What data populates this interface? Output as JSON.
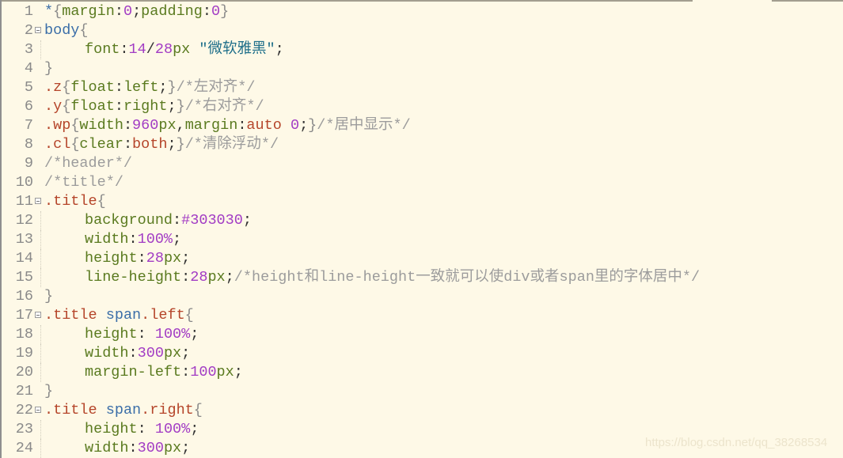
{
  "editor": {
    "background": "#fef9e7",
    "lines": [
      {
        "n": "1",
        "fold": false,
        "indent": false,
        "tokens": [
          {
            "t": "*",
            "c": "tag"
          },
          {
            "t": "{",
            "c": "brace"
          },
          {
            "t": "margin",
            "c": "prop"
          },
          {
            "t": ":",
            "c": "pun"
          },
          {
            "t": "0",
            "c": "num"
          },
          {
            "t": ";",
            "c": "pun"
          },
          {
            "t": "padding",
            "c": "prop"
          },
          {
            "t": ":",
            "c": "pun"
          },
          {
            "t": "0",
            "c": "num"
          },
          {
            "t": "}",
            "c": "brace"
          }
        ]
      },
      {
        "n": "2",
        "fold": true,
        "indent": false,
        "tokens": [
          {
            "t": "body",
            "c": "tag"
          },
          {
            "t": "{",
            "c": "brace"
          }
        ]
      },
      {
        "n": "3",
        "fold": false,
        "indent": true,
        "tokens": [
          {
            "t": "font",
            "c": "prop"
          },
          {
            "t": ":",
            "c": "pun"
          },
          {
            "t": "14",
            "c": "num"
          },
          {
            "t": "/",
            "c": "pun"
          },
          {
            "t": "28",
            "c": "num"
          },
          {
            "t": "px",
            "c": "prop"
          },
          {
            "t": " ",
            "c": "pun"
          },
          {
            "t": "\"微软雅黑\"",
            "c": "str"
          },
          {
            "t": ";",
            "c": "pun"
          }
        ]
      },
      {
        "n": "4",
        "fold": false,
        "indent": false,
        "tokens": [
          {
            "t": "}",
            "c": "brace"
          }
        ]
      },
      {
        "n": "5",
        "fold": false,
        "indent": false,
        "tokens": [
          {
            "t": ".z",
            "c": "sel"
          },
          {
            "t": "{",
            "c": "brace"
          },
          {
            "t": "float",
            "c": "prop"
          },
          {
            "t": ":",
            "c": "pun"
          },
          {
            "t": "left",
            "c": "prop"
          },
          {
            "t": ";",
            "c": "pun"
          },
          {
            "t": "}",
            "c": "brace"
          },
          {
            "t": "/*左对齐*/",
            "c": "cmt"
          }
        ]
      },
      {
        "n": "6",
        "fold": false,
        "indent": false,
        "tokens": [
          {
            "t": ".y",
            "c": "sel"
          },
          {
            "t": "{",
            "c": "brace"
          },
          {
            "t": "float",
            "c": "prop"
          },
          {
            "t": ":",
            "c": "pun"
          },
          {
            "t": "right",
            "c": "prop"
          },
          {
            "t": ";",
            "c": "pun"
          },
          {
            "t": "}",
            "c": "brace"
          },
          {
            "t": "/*右对齐*/",
            "c": "cmt"
          }
        ]
      },
      {
        "n": "7",
        "fold": false,
        "indent": false,
        "tokens": [
          {
            "t": ".wp",
            "c": "sel"
          },
          {
            "t": "{",
            "c": "brace"
          },
          {
            "t": "width",
            "c": "prop"
          },
          {
            "t": ":",
            "c": "pun"
          },
          {
            "t": "960",
            "c": "num"
          },
          {
            "t": "px",
            "c": "prop"
          },
          {
            "t": ",",
            "c": "pun"
          },
          {
            "t": "margin",
            "c": "prop"
          },
          {
            "t": ":",
            "c": "pun"
          },
          {
            "t": "auto",
            "c": "kw"
          },
          {
            "t": " ",
            "c": "pun"
          },
          {
            "t": "0",
            "c": "num"
          },
          {
            "t": ";",
            "c": "pun"
          },
          {
            "t": "}",
            "c": "brace"
          },
          {
            "t": "/*居中显示*/",
            "c": "cmt"
          }
        ]
      },
      {
        "n": "8",
        "fold": false,
        "indent": false,
        "tokens": [
          {
            "t": ".cl",
            "c": "sel"
          },
          {
            "t": "{",
            "c": "brace"
          },
          {
            "t": "clear",
            "c": "prop"
          },
          {
            "t": ":",
            "c": "pun"
          },
          {
            "t": "both",
            "c": "kw"
          },
          {
            "t": ";",
            "c": "pun"
          },
          {
            "t": "}",
            "c": "brace"
          },
          {
            "t": "/*清除浮动*/",
            "c": "cmt"
          }
        ]
      },
      {
        "n": "9",
        "fold": false,
        "indent": false,
        "tokens": [
          {
            "t": "/*header*/",
            "c": "cmt"
          }
        ]
      },
      {
        "n": "10",
        "fold": false,
        "indent": false,
        "tokens": [
          {
            "t": "/*title*/",
            "c": "cmt"
          }
        ]
      },
      {
        "n": "11",
        "fold": true,
        "indent": false,
        "tokens": [
          {
            "t": ".title",
            "c": "sel"
          },
          {
            "t": "{",
            "c": "brace"
          }
        ]
      },
      {
        "n": "12",
        "fold": false,
        "indent": true,
        "tokens": [
          {
            "t": "background",
            "c": "prop"
          },
          {
            "t": ":",
            "c": "pun"
          },
          {
            "t": "#303030",
            "c": "num"
          },
          {
            "t": ";",
            "c": "pun"
          }
        ]
      },
      {
        "n": "13",
        "fold": false,
        "indent": true,
        "tokens": [
          {
            "t": "width",
            "c": "prop"
          },
          {
            "t": ":",
            "c": "pun"
          },
          {
            "t": "100%",
            "c": "num"
          },
          {
            "t": ";",
            "c": "pun"
          }
        ]
      },
      {
        "n": "14",
        "fold": false,
        "indent": true,
        "tokens": [
          {
            "t": "height",
            "c": "prop"
          },
          {
            "t": ":",
            "c": "pun"
          },
          {
            "t": "28",
            "c": "num"
          },
          {
            "t": "px",
            "c": "prop"
          },
          {
            "t": ";",
            "c": "pun"
          }
        ]
      },
      {
        "n": "15",
        "fold": false,
        "indent": true,
        "tokens": [
          {
            "t": "line-height",
            "c": "prop"
          },
          {
            "t": ":",
            "c": "pun"
          },
          {
            "t": "28",
            "c": "num"
          },
          {
            "t": "px",
            "c": "prop"
          },
          {
            "t": ";",
            "c": "pun"
          },
          {
            "t": "/*height和line-height一致就可以使div或者span里的字体居中*/",
            "c": "cmt"
          }
        ]
      },
      {
        "n": "16",
        "fold": false,
        "indent": false,
        "tokens": [
          {
            "t": "}",
            "c": "brace"
          }
        ]
      },
      {
        "n": "17",
        "fold": true,
        "indent": false,
        "tokens": [
          {
            "t": ".title",
            "c": "sel"
          },
          {
            "t": " ",
            "c": "pun"
          },
          {
            "t": "span",
            "c": "tag"
          },
          {
            "t": ".left",
            "c": "sel"
          },
          {
            "t": "{",
            "c": "brace"
          }
        ]
      },
      {
        "n": "18",
        "fold": false,
        "indent": true,
        "tokens": [
          {
            "t": "height",
            "c": "prop"
          },
          {
            "t": ": ",
            "c": "pun"
          },
          {
            "t": "100%",
            "c": "num"
          },
          {
            "t": ";",
            "c": "pun"
          }
        ]
      },
      {
        "n": "19",
        "fold": false,
        "indent": true,
        "tokens": [
          {
            "t": "width",
            "c": "prop"
          },
          {
            "t": ":",
            "c": "pun"
          },
          {
            "t": "300",
            "c": "num"
          },
          {
            "t": "px",
            "c": "prop"
          },
          {
            "t": ";",
            "c": "pun"
          }
        ]
      },
      {
        "n": "20",
        "fold": false,
        "indent": true,
        "tokens": [
          {
            "t": "margin-left",
            "c": "prop"
          },
          {
            "t": ":",
            "c": "pun"
          },
          {
            "t": "100",
            "c": "num"
          },
          {
            "t": "px",
            "c": "prop"
          },
          {
            "t": ";",
            "c": "pun"
          }
        ]
      },
      {
        "n": "21",
        "fold": false,
        "indent": false,
        "tokens": [
          {
            "t": "}",
            "c": "brace"
          }
        ]
      },
      {
        "n": "22",
        "fold": true,
        "indent": false,
        "tokens": [
          {
            "t": ".title",
            "c": "sel"
          },
          {
            "t": " ",
            "c": "pun"
          },
          {
            "t": "span",
            "c": "tag"
          },
          {
            "t": ".right",
            "c": "sel"
          },
          {
            "t": "{",
            "c": "brace"
          }
        ]
      },
      {
        "n": "23",
        "fold": false,
        "indent": true,
        "tokens": [
          {
            "t": "height",
            "c": "prop"
          },
          {
            "t": ": ",
            "c": "pun"
          },
          {
            "t": "100%",
            "c": "num"
          },
          {
            "t": ";",
            "c": "pun"
          }
        ]
      },
      {
        "n": "24",
        "fold": false,
        "indent": true,
        "tokens": [
          {
            "t": "width",
            "c": "prop"
          },
          {
            "t": ":",
            "c": "pun"
          },
          {
            "t": "300",
            "c": "num"
          },
          {
            "t": "px",
            "c": "prop"
          },
          {
            "t": ";",
            "c": "pun"
          }
        ]
      }
    ]
  },
  "watermark": "https://blog.csdn.net/qq_38268534"
}
